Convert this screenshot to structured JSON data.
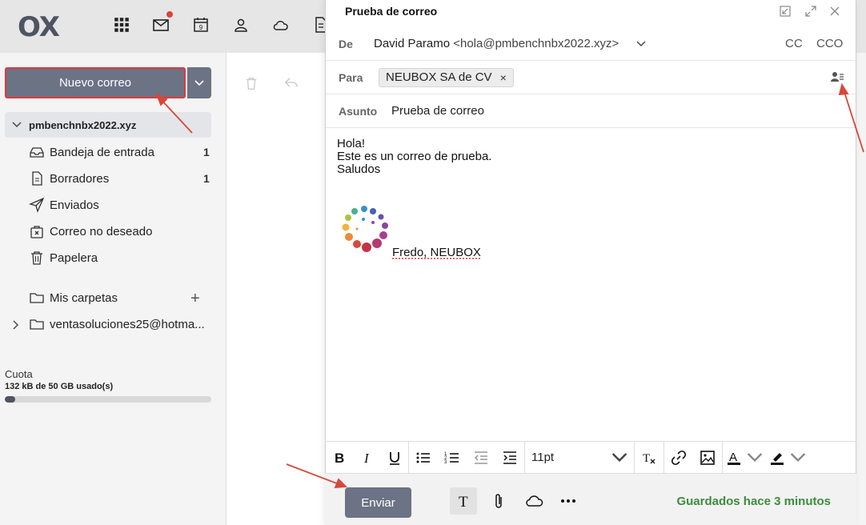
{
  "app": {
    "logo_text": "OX"
  },
  "topbar": {
    "icons": [
      "apps-grid-icon",
      "mail-icon",
      "calendar-icon",
      "contacts-icon",
      "drive-cloud-icon",
      "documents-icon"
    ],
    "calendar_day": "9"
  },
  "sidebar": {
    "new_mail_label": "Nuevo correo",
    "account": "pmbenchnbx2022.xyz",
    "folders": [
      {
        "label": "Bandeja de entrada",
        "count": "1",
        "icon": "inbox-icon"
      },
      {
        "label": "Borradores",
        "count": "1",
        "icon": "drafts-icon"
      },
      {
        "label": "Enviados",
        "count": "",
        "icon": "send-icon"
      },
      {
        "label": "Correo no deseado",
        "count": "",
        "icon": "spam-icon"
      },
      {
        "label": "Papelera",
        "count": "",
        "icon": "trash-icon"
      }
    ],
    "my_folders_label": "Mis carpetas",
    "external_account": "ventasoluciones25@hotma...",
    "quota_label": "Cuota",
    "quota_value": "132 kB de 50 GB usado(s)",
    "quota_fraction": 0.05
  },
  "compose": {
    "title": "Prueba de correo",
    "from_label": "De",
    "from_name": "David Paramo",
    "from_email": "<hola@pmbenchnbx2022.xyz>",
    "cc_label": "CC",
    "bcc_label": "CCO",
    "to_label": "Para",
    "to_recipient": "NEUBOX SA de CV",
    "subject_label": "Asunto",
    "subject_value": "Prueba de correo",
    "body_lines": [
      "Hola!",
      "Este es un correo de prueba.",
      "Saludos"
    ],
    "signature_text": "Fredo, NEUBOX",
    "font_size": "11pt",
    "send_label": "Enviar",
    "saved_status": "Guardados hace 3 minutos"
  },
  "colors": {
    "button_bg": "#6b7384",
    "annotation_red": "#e2383a",
    "saved_green": "#3d8c3d"
  }
}
